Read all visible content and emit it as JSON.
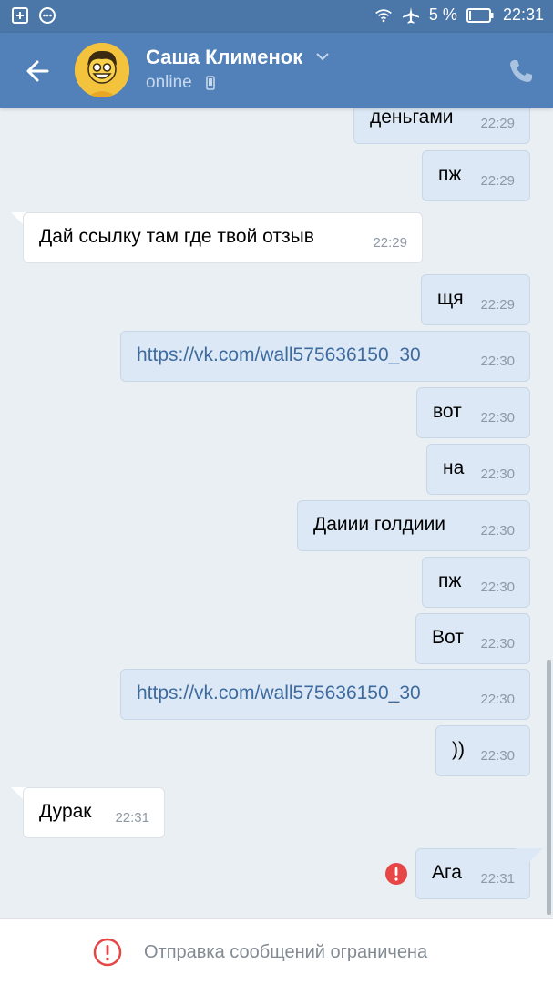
{
  "status_bar": {
    "battery": "5 %",
    "time": "22:31",
    "icons": [
      "add-box-icon",
      "more-circle-icon",
      "wifi-icon",
      "airplane-icon",
      "battery-icon"
    ]
  },
  "header": {
    "contact_name": "Саша Клименок",
    "status": "online",
    "icons": [
      "back-arrow-icon",
      "chevron-down-icon",
      "mobile-device-icon",
      "phone-call-icon"
    ]
  },
  "messages": [
    {
      "dir": "out",
      "text": "деньгами",
      "time": "22:29"
    },
    {
      "dir": "out",
      "text": "пж",
      "time": "22:29"
    },
    {
      "dir": "in",
      "text": "Дай ссылку там где твой отзыв",
      "time": "22:29"
    },
    {
      "dir": "out",
      "text": "щя",
      "time": "22:29"
    },
    {
      "dir": "out",
      "text": "https://vk.com/wall575636150_30",
      "time": "22:30",
      "link": true
    },
    {
      "dir": "out",
      "text": "вот",
      "time": "22:30"
    },
    {
      "dir": "out",
      "text": "на",
      "time": "22:30"
    },
    {
      "dir": "out",
      "text": "Даиии голдиии",
      "time": "22:30"
    },
    {
      "dir": "out",
      "text": "пж",
      "time": "22:30"
    },
    {
      "dir": "out",
      "text": "Вот",
      "time": "22:30"
    },
    {
      "dir": "out",
      "text": "https://vk.com/wall575636150_30",
      "time": "22:30",
      "link": true
    },
    {
      "dir": "out",
      "text": "))",
      "time": "22:30"
    },
    {
      "dir": "in",
      "text": "Дурак",
      "time": "22:31"
    },
    {
      "dir": "out",
      "text": "Ага",
      "time": "22:31",
      "failed": true
    }
  ],
  "footer": {
    "notice": "Отправка сообщений ограничена",
    "icon": "error-circle-icon"
  },
  "colors": {
    "header": "#5181b8",
    "status_bar": "#4a76a8",
    "outgoing_bubble": "#dce8f5",
    "incoming_bubble": "#ffffff",
    "link": "#3e6b9e",
    "error": "#e64646"
  }
}
